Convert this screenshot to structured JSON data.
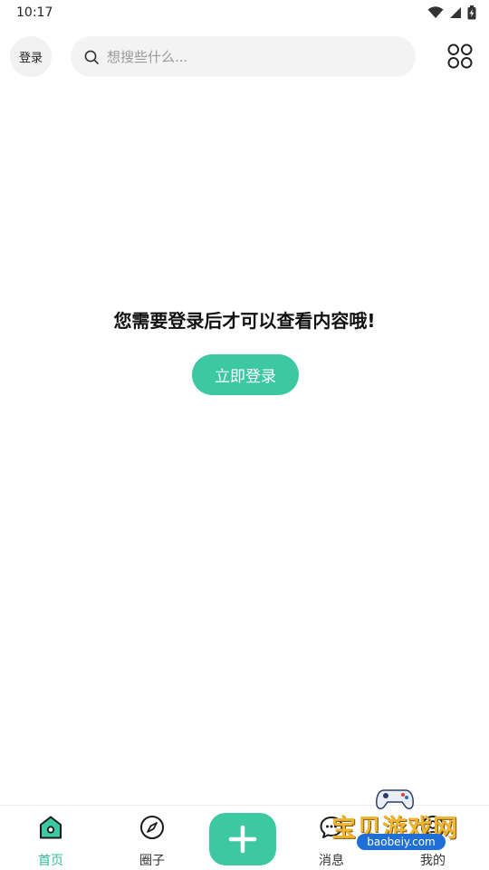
{
  "status_bar": {
    "time": "10:17"
  },
  "header": {
    "login_label": "登录",
    "search_placeholder": "想搜些什么..."
  },
  "main": {
    "prompt": "您需要登录后才可以查看内容哦!",
    "login_button": "立即登录"
  },
  "bottom_nav": {
    "items": [
      {
        "label": "首页",
        "icon": "home-icon",
        "active": true
      },
      {
        "label": "圈子",
        "icon": "compass-icon",
        "active": false
      },
      {
        "label": "",
        "icon": "plus-icon",
        "active": false
      },
      {
        "label": "消息",
        "icon": "message-icon",
        "active": false
      },
      {
        "label": "我的",
        "icon": "profile-icon",
        "active": false
      }
    ]
  },
  "watermark": {
    "name": "宝贝游戏网",
    "url": "baobeiy.com"
  },
  "colors": {
    "accent": "#3cc9a2",
    "accent_text": "#2fbf97",
    "search_bg": "#f3f3f3"
  }
}
